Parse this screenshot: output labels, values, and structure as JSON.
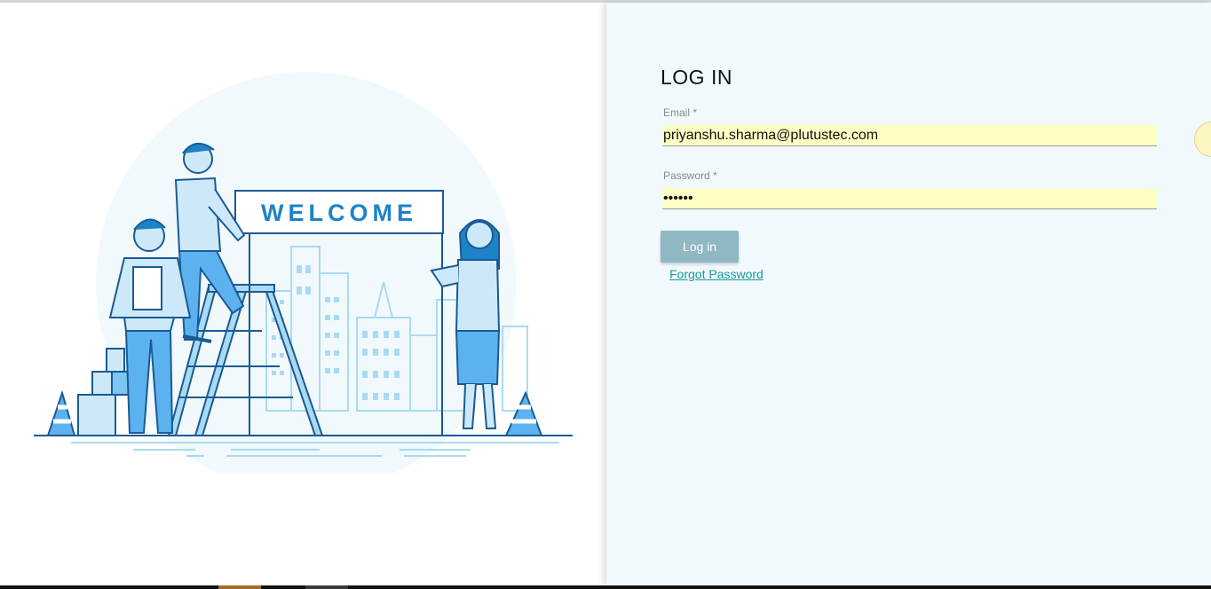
{
  "login": {
    "title": "LOG IN",
    "email_label": "Email *",
    "email_value": "priyanshu.sharma@plutustec.com",
    "password_label": "Password *",
    "password_value": "••••••",
    "login_button": "Log in",
    "forgot_link": "Forgot Password"
  },
  "illustration": {
    "sign_text": "WELCOME"
  },
  "colors": {
    "right_bg": "#f1f9fd",
    "autofill_bg": "#fdfdc4",
    "button_bg": "#8fb8c2",
    "link": "#1a9a9e",
    "illustration_blue": "#1e82c8"
  }
}
